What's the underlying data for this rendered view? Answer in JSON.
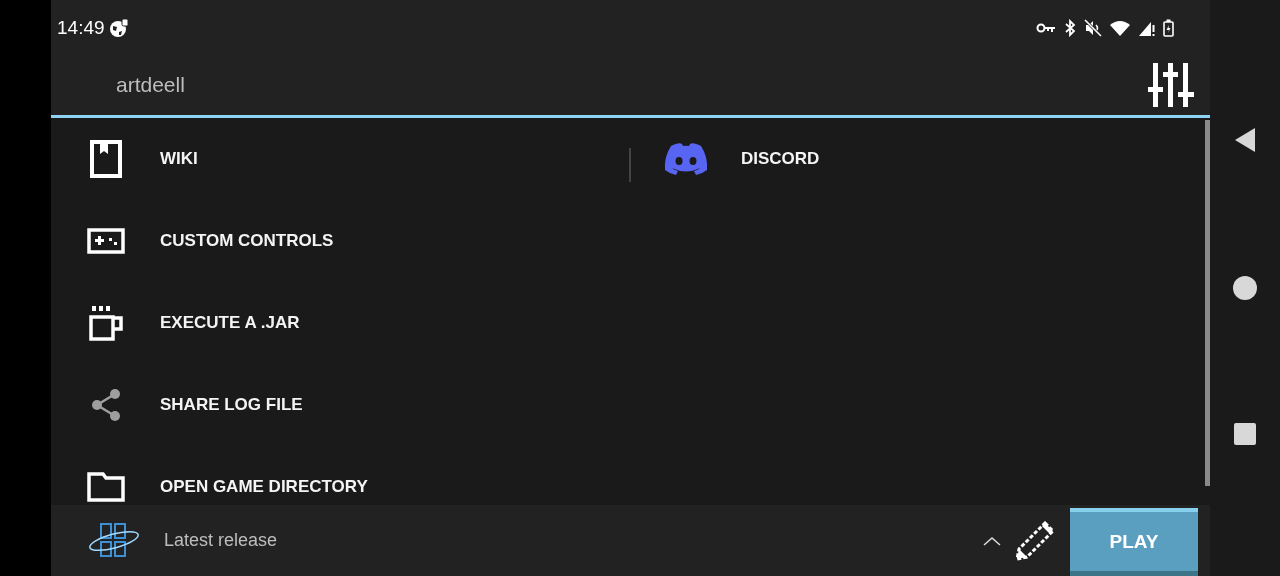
{
  "status_bar": {
    "time": "14:49"
  },
  "header": {
    "account": "artdeell"
  },
  "menu": [
    {
      "kind": "wiki",
      "label": "WIKI"
    },
    {
      "kind": "controls",
      "label": "CUSTOM CONTROLS"
    },
    {
      "kind": "jar",
      "label": "EXECUTE A .JAR"
    },
    {
      "kind": "share",
      "label": "SHARE LOG FILE"
    },
    {
      "kind": "folder",
      "label": "OPEN GAME DIRECTORY"
    }
  ],
  "side_link": {
    "kind": "discord",
    "label": "DISCORD"
  },
  "bottom_bar": {
    "version": "Latest release",
    "play_button": "PLAY"
  }
}
